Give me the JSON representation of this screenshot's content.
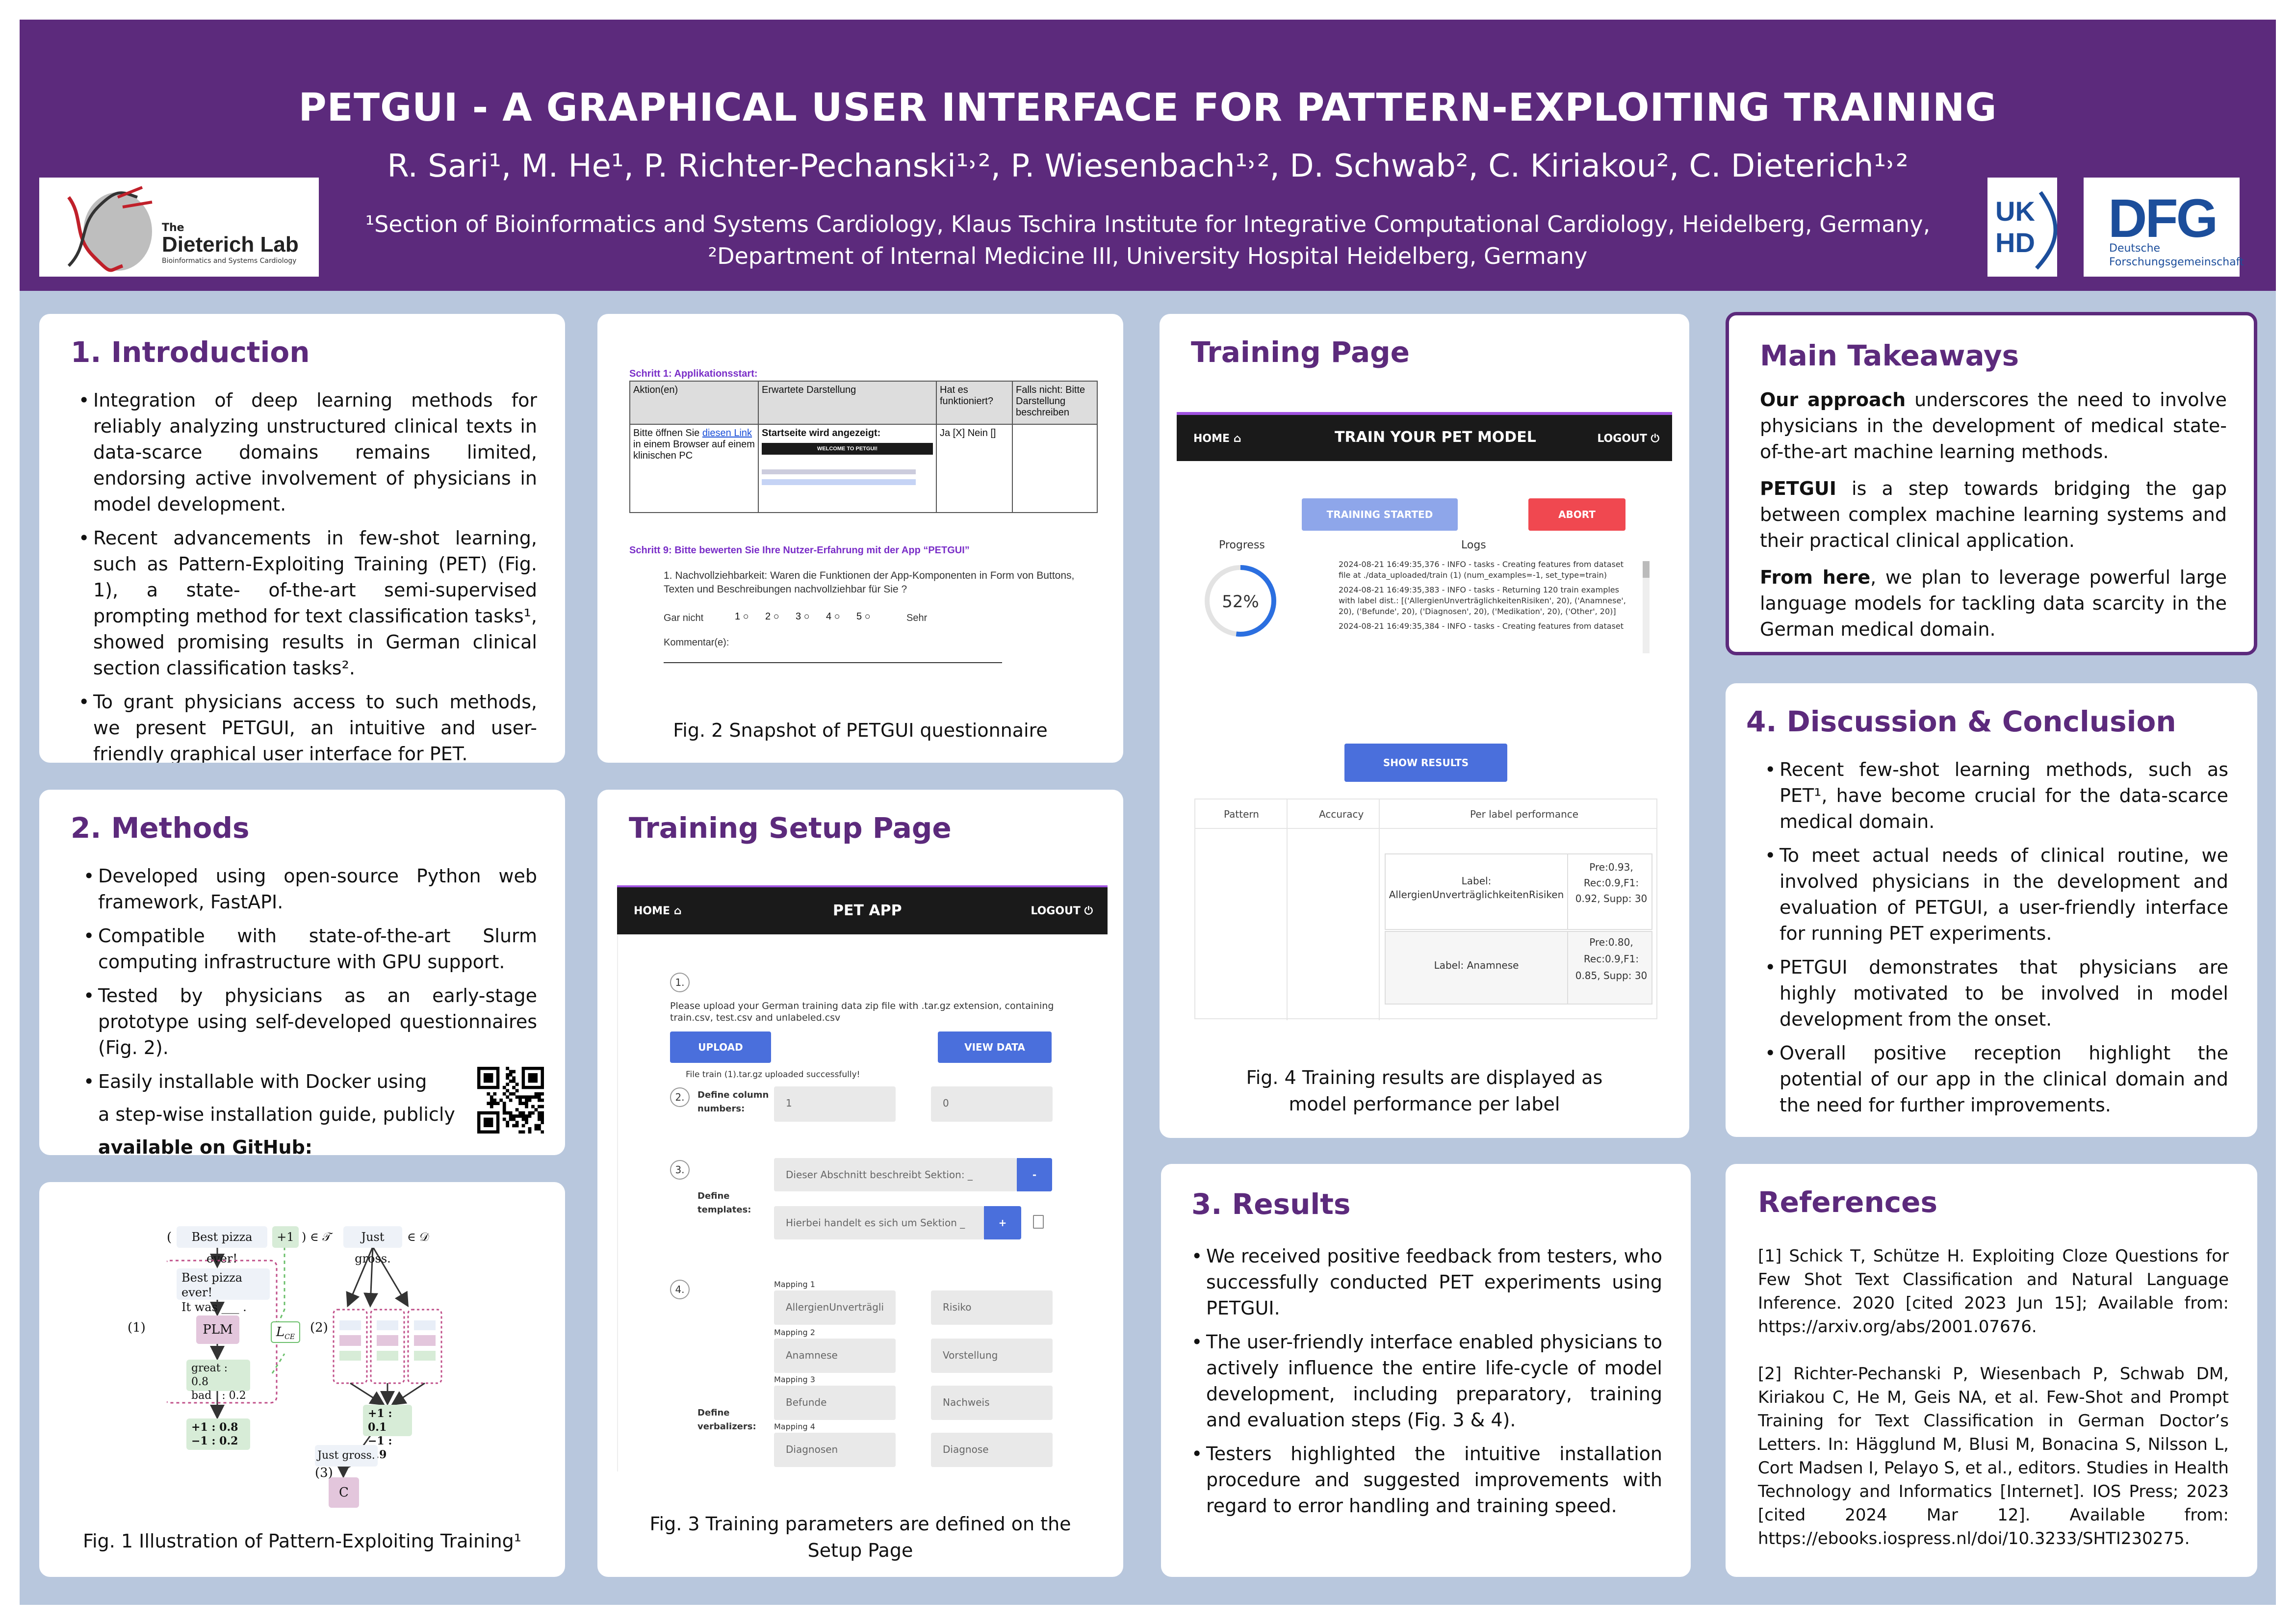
{
  "header": {
    "title": "PETGUI - A GRAPHICAL USER INTERFACE FOR PATTERN-EXPLOITING TRAINING",
    "authors": "R. Sari¹, M. He¹, P. Richter-Pechanski¹˒², P. Wiesenbach¹˒², D. Schwab², C. Kiriakou², C. Dieterich¹˒²",
    "aff1": "¹Section of Bioinformatics and Systems Cardiology, Klaus Tschira Institute for Integrative Computational Cardiology, Heidelberg, Germany,",
    "aff2": "²Department of Internal Medicine III, University Hospital Heidelberg, Germany",
    "logo_left_line1": "The",
    "logo_left_line2": "Dieterich Lab",
    "logo_left_line3": "Bioinformatics and Systems Cardiology",
    "logo_ukhd_1": "UK",
    "logo_ukhd_2": "HD",
    "logo_dfg": "DFG",
    "logo_dfg_sub1": "Deutsche",
    "logo_dfg_sub2": "Forschungsgemeinschaft"
  },
  "intro": {
    "title": "1. Introduction",
    "b1": "Integration of deep learning methods for reliably analyzing unstructured clinical texts in data-scarce domains remains limited, endorsing active involvement of physicians in model development.",
    "b2": "Recent advancements in few-shot learning, such as Pattern-Exploiting Training (PET) (Fig. 1), a state- of-the-art semi-supervised prompting method for text classification tasks¹, showed promising results in German clinical section classification tasks².",
    "b3": "To grant physicians access to such methods, we present PETGUI, an intuitive and user-friendly graphical user interface for PET."
  },
  "fig2": {
    "step1": "Schritt 1: Applikationsstart:",
    "h_aktion": "Aktion(en)",
    "h_erwartet": "Erwartete Darstellung",
    "h_hat": "Hat es funktioniert?",
    "h_falls": "Falls nicht: Bitte Darstellung beschreiben",
    "c_aktion_a": "Bitte öffnen Sie",
    "c_aktion_link": "diesen Link",
    "c_aktion_b": "in einem Browser auf einem klinischen PC",
    "c_start": "Startseite wird angezeigt:",
    "c_welcome": "WELCOME TO PETGUI!",
    "c_ja": "Ja [X] Nein []",
    "step9": "Schritt 9: Bitte bewerten Sie Ihre Nutzer-Erfahrung mit der App “PETGUI”",
    "q1": "1.  Nachvollziehbarkeit: Waren die Funktionen der App-Komponenten in Form von Buttons, Texten und Beschreibungen nachvollziehbar für Sie ?",
    "gar": "Gar nicht",
    "sehr": "Sehr",
    "scale": [
      "1",
      "2",
      "3",
      "4",
      "5"
    ],
    "komm": "Kommentar(e):",
    "caption": "Fig. 2 Snapshot of PETGUI questionnaire"
  },
  "training": {
    "title": "Training Page",
    "nav_home": "HOME ⌂",
    "nav_title": "TRAIN YOUR PET MODEL",
    "nav_logout": "LOGOUT ⏻",
    "btn_started": "TRAINING STARTED",
    "btn_abort": "ABORT",
    "progress_label": "Progress",
    "progress_value": 0.52,
    "progress_text": "52%",
    "logs_label": "Logs",
    "log1": "2024-08-21 16:49:35,376 - INFO - tasks - Creating features from dataset file at ./data_uploaded/train (1) (num_examples=-1, set_type=train)",
    "log2": "2024-08-21 16:49:35,383 - INFO - tasks - Returning 120 train examples with label dist.: [('AllergienUnverträglichkeitenRisiken', 20), ('Anamnese', 20), ('Befunde', 20), ('Diagnosen', 20), ('Medikation', 20), ('Other', 20)]",
    "log3": "2024-08-21 16:49:35,384 - INFO - tasks - Creating features from dataset",
    "btn_show": "SHOW RESULTS",
    "th_pattern": "Pattern",
    "th_acc": "Accuracy",
    "th_per": "Per label performance",
    "r1_label": "Label: AllergienUnverträglichkeitenRisiken",
    "r1_val": "Pre:0.93, Rec:0.9,F1: 0.92, Supp: 30",
    "r2_label": "Label: Anamnese",
    "r2_val": "Pre:0.80, Rec:0.9,F1: 0.85, Supp: 30",
    "caption": "Fig. 4 Training results are displayed as model performance per label"
  },
  "takeaways": {
    "title": "Main Takeaways",
    "p1_b": "Our approach",
    "p1": " underscores the need to involve physicians in the development of medical state-of-the-art machine learning methods.",
    "p2_b": "PETGUI",
    "p2": " is a step towards bridging the gap between complex machine learning systems and their practical clinical application.",
    "p3_b": "From here",
    "p3": ", we plan to leverage powerful large language models for tackling data scarcity in the German medical domain."
  },
  "methods": {
    "title": "2. Methods",
    "b1": "Developed using open-source Python web framework, FastAPI.",
    "b2": "Compatible with state-of-the-art Slurm computing infrastructure with GPU support.",
    "b3": "Tested by physicians as an early-stage prototype using self-developed questionnaires (Fig. 2).",
    "b4a": "Easily installable with Docker using",
    "b4b": "a step-wise installation guide, publicly",
    "b4c": "available on GitHub:"
  },
  "setup": {
    "title": "Training Setup Page",
    "nav_home": "HOME ⌂",
    "nav_title": "PET APP",
    "nav_logout": "LOGOUT ⏻",
    "s1": "1.",
    "upload_text": "Please upload your German training data zip file with .tar.gz extension, containing train.csv, test.csv and unlabeled.csv",
    "btn_upload": "UPLOAD",
    "btn_view": "VIEW DATA",
    "uploaded": "File train (1).tar.gz uploaded successfully!",
    "s2": "2.",
    "define_col": "Define column numbers:",
    "col1": "1",
    "col2": "0",
    "s3": "3.",
    "define_tpl": "Define templates:",
    "tpl1": "Dieser Abschnitt beschreibt Sektion: _",
    "tpl2": "Hierbei handelt es sich um Sektion _",
    "minus": "-",
    "plus": "+",
    "s4": "4.",
    "define_verb": "Define verbalizers:",
    "m1": "Mapping 1",
    "m1a": "AllergienUnverträgli",
    "m1b": "Risiko",
    "m2": "Mapping 2",
    "m2a": "Anamnese",
    "m2b": "Vorstellung",
    "m3": "Mapping 3",
    "m3a": "Befunde",
    "m3b": "Nachweis",
    "m4": "Mapping 4",
    "m4a": "Diagnosen",
    "m4b": "Diagnose",
    "caption": "Fig. 3 Training parameters are defined on the Setup Page"
  },
  "fig1": {
    "input": "Best pizza ever!",
    "plus1": "+1",
    "inT": ") ∈ 𝒯",
    "open": "(",
    "just": "Just gross.",
    "inD": "∈ 𝒟",
    "pattern1": "Best pizza ever!",
    "pattern2": "It was ___ .",
    "lab1": "(1)",
    "lab2": "(2)",
    "lab3": "(3)",
    "plm": "PLM",
    "lce": "L",
    "lce_sub": "CE",
    "great": "great : 0.8",
    "bad": "bad   : 0.2",
    "pp1": "+1 : 0.8",
    "pm1": "−1 : 0.2",
    "ens1": "+1 : 0.1",
    "ens2": "−1 : 0.9",
    "just2": "Just gross.",
    "c": "C",
    "caption": "Fig. 1 Illustration of Pattern-Exploiting Training¹"
  },
  "discussion": {
    "title": "4. Discussion & Conclusion",
    "b1": "Recent few-shot learning methods, such as PET¹, have become crucial for the data-scarce medical domain.",
    "b2": "To meet actual needs of clinical routine, we involved physicians in the development and evaluation of PETGUI, a user-friendly interface for running PET experiments.",
    "b3": "PETGUI demonstrates that physicians are highly motivated to be involved in model development from the onset.",
    "b4": "Overall positive reception highlight the potential of our app in the clinical domain and the need for further improvements."
  },
  "results": {
    "title": "3. Results",
    "b1": "We received positive feedback from testers, who successfully conducted PET experiments using PETGUI.",
    "b2": "The user-friendly interface enabled physicians to actively influence the entire life-cycle of model development, including preparatory, training and evaluation steps (Fig. 3 & 4).",
    "b3": "Testers highlighted the intuitive installation procedure and suggested improvements with regard to error handling and training speed."
  },
  "references": {
    "title": "References",
    "r1": "[1] Schick T, Schütze H. Exploiting Cloze Questions for Few Shot Text Classification and Natural Language Inference. 2020 [cited 2023 Jun 15]; Available from: https://arxiv.org/abs/2001.07676.",
    "r2": "[2] Richter-Pechanski P, Wiesenbach P, Schwab DM, Kiriakou C, He M, Geis NA, et al. Few-Shot and Prompt Training for Text Classification in German Doctor’s Letters. In: Hägglund M, Blusi M, Bonacina S, Nilsson L, Cort Madsen I, Pelayo S, et al., editors. Studies in Health Technology and Informatics [Internet]. IOS Press; 2023 [cited 2024 Mar 12]. Available from: https://ebooks.iospress.nl/doi/10.3233/SHTI230275."
  },
  "colors": {
    "purple": "#5c2a7c",
    "blue": "#4a6fdc",
    "red": "#f04850",
    "background": "#b8c7dd"
  }
}
